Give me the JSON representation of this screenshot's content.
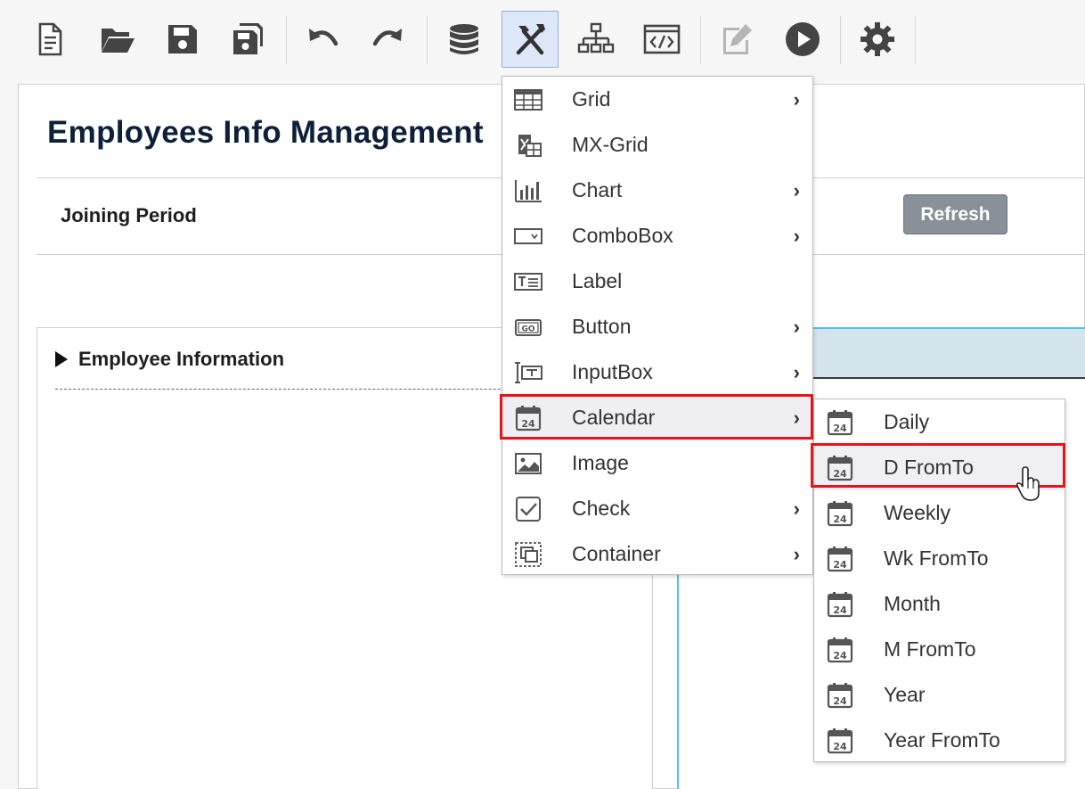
{
  "toolbar": {
    "buttons": [
      {
        "name": "new-document",
        "icon": "new-document-icon"
      },
      {
        "name": "open-folder",
        "icon": "open-folder-icon"
      },
      {
        "name": "save",
        "icon": "save-icon"
      },
      {
        "name": "save-all",
        "icon": "save-all-icon"
      },
      {
        "name": "undo",
        "icon": "undo-icon"
      },
      {
        "name": "redo",
        "icon": "redo-icon"
      },
      {
        "name": "database",
        "icon": "database-icon"
      },
      {
        "name": "components",
        "icon": "tools-icon",
        "active": true
      },
      {
        "name": "structure",
        "icon": "sitemap-icon"
      },
      {
        "name": "code",
        "icon": "code-icon"
      },
      {
        "name": "edit",
        "icon": "edit-icon",
        "disabled": true
      },
      {
        "name": "run",
        "icon": "play-icon"
      },
      {
        "name": "settings",
        "icon": "gear-icon"
      }
    ]
  },
  "page": {
    "title": "Employees Info Management",
    "joining_label": "Joining Period",
    "refresh_label": "Refresh",
    "section_title": "Employee Information"
  },
  "menu": {
    "items": [
      {
        "label": "Grid",
        "icon": "grid-icon",
        "submenu": true
      },
      {
        "label": "MX-Grid",
        "icon": "mx-grid-icon",
        "submenu": false
      },
      {
        "label": "Chart",
        "icon": "chart-icon",
        "submenu": true
      },
      {
        "label": "ComboBox",
        "icon": "combobox-icon",
        "submenu": true
      },
      {
        "label": "Label",
        "icon": "label-icon",
        "submenu": false
      },
      {
        "label": "Button",
        "icon": "button-icon",
        "submenu": true
      },
      {
        "label": "InputBox",
        "icon": "inputbox-icon",
        "submenu": true
      },
      {
        "label": "Calendar",
        "icon": "calendar-icon",
        "submenu": true,
        "highlighted": true
      },
      {
        "label": "Image",
        "icon": "image-icon",
        "submenu": false
      },
      {
        "label": "Check",
        "icon": "checkbox-icon",
        "submenu": true
      },
      {
        "label": "Container",
        "icon": "container-icon",
        "submenu": true
      }
    ],
    "arrow": "›"
  },
  "calendar_submenu": {
    "items": [
      {
        "label": "Daily"
      },
      {
        "label": "D FromTo",
        "highlighted": true
      },
      {
        "label": "Weekly"
      },
      {
        "label": "Wk FromTo"
      },
      {
        "label": "Month"
      },
      {
        "label": "M FromTo"
      },
      {
        "label": "Year"
      },
      {
        "label": "Year FromTo"
      }
    ],
    "icon_number": "24"
  },
  "colors": {
    "highlight_border": "#e8141a",
    "title": "#0e2039",
    "refresh_bg": "#8a9097",
    "panel_accent": "#4fc3e8"
  }
}
